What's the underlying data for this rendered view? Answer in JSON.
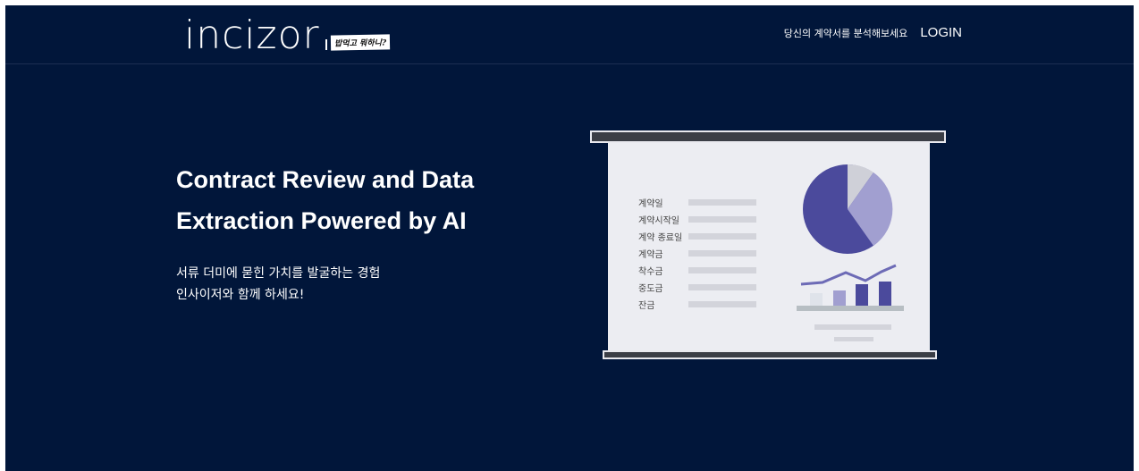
{
  "brand": {
    "logo_text": "incizor",
    "tagline": "밥먹고 뭐하니?"
  },
  "nav": {
    "analyze_link": "당신의 계약서를 분석해보세요",
    "login": "LOGIN"
  },
  "hero": {
    "title_line1": "Contract Review and Data",
    "title_line2": "Extraction Powered by AI",
    "sub_line1": "서류 더미에 묻힌 가치를 발굴하는 경험",
    "sub_line2": "인사이저와 함께 하세요!"
  },
  "illustration": {
    "fields": [
      {
        "label": "계약일"
      },
      {
        "label": "계약시작일"
      },
      {
        "label": "계약 종료일"
      },
      {
        "label": "계약금"
      },
      {
        "label": "착수금"
      },
      {
        "label": "중도금"
      },
      {
        "label": "잔금"
      }
    ],
    "colors": {
      "dark_purple": "#4b4a9c",
      "light_purple": "#a19fd0",
      "grey": "#cfd0d8",
      "pale": "#dfe3ea"
    }
  }
}
